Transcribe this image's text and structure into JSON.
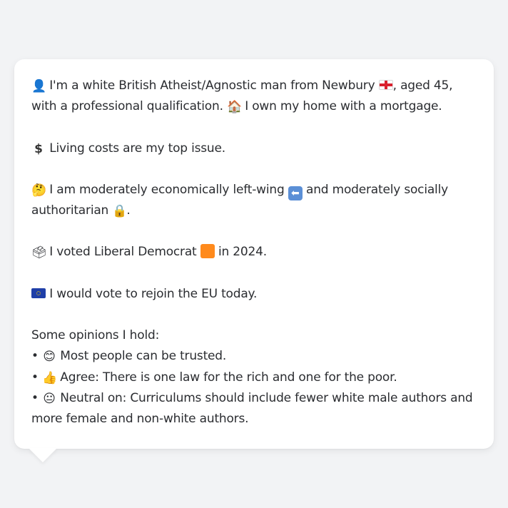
{
  "profile": {
    "line1": {
      "icon": "person-silhouette-icon",
      "text_a": "I'm a white British Atheist/Agnostic man from Newbury",
      "flag": "england-flag-icon",
      "text_b": ", aged 45, with a professional qualification.",
      "home_icon": "house-icon",
      "text_c": "I own my home with a mortgage."
    },
    "line2": {
      "icon": "dollar-sign-icon",
      "text": "Living costs are my top issue."
    },
    "line3": {
      "icon": "thinking-face-icon",
      "text_a": "I am moderately economically left-wing",
      "arrow_icon": "left-arrow-icon",
      "text_b": "and moderately socially authoritarian",
      "lock_icon": "lock-icon",
      "text_c": "."
    },
    "line4": {
      "icon": "ballot-box-icon",
      "text_a": "I voted Liberal Democrat",
      "swatch": "orange-square-icon",
      "swatch_color": "#ff8a1c",
      "text_b": "in 2024."
    },
    "line5": {
      "icon": "eu-flag-icon",
      "text": "I would vote to rejoin the EU today."
    },
    "opinions": {
      "heading": "Some opinions I hold:",
      "items": [
        {
          "bullet": "•",
          "icon": "smiling-face-icon",
          "text": "Most people can be trusted."
        },
        {
          "bullet": "•",
          "icon": "thumbs-up-icon",
          "text": "Agree: There is one law for the rich and one for the poor."
        },
        {
          "bullet": "•",
          "icon": "neutral-face-icon",
          "text": "Neutral on: Curriculums should include fewer white male authors and more female and non-white authors."
        }
      ]
    }
  },
  "colors": {
    "background": "#f2f3f5",
    "bubble": "#ffffff",
    "text": "#2b2d31"
  }
}
